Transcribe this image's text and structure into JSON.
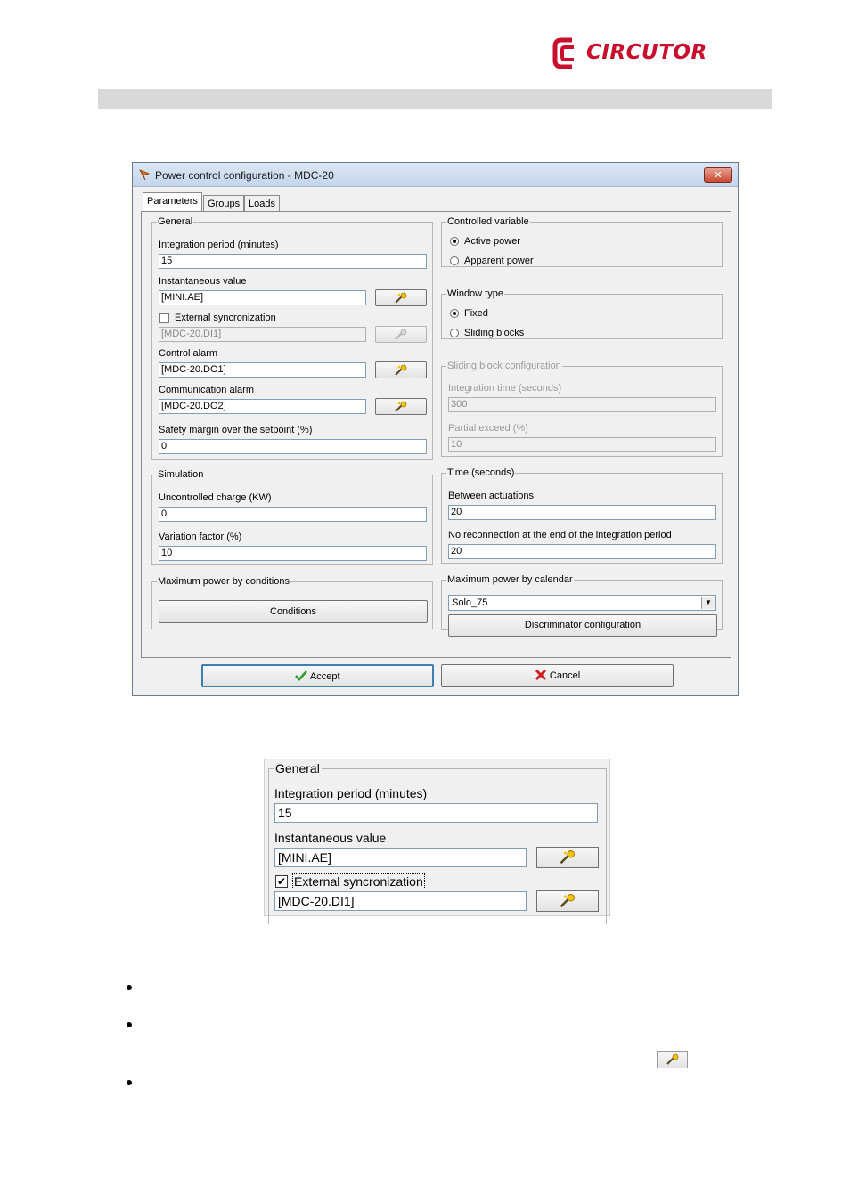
{
  "brand": {
    "logo_text": "CIRCUTOR",
    "color": "#c8102e"
  },
  "window": {
    "title": "Power control configuration - MDC-20",
    "close_glyph": "✕",
    "tabs": [
      "Parameters",
      "Groups",
      "Loads"
    ],
    "active_tab": "Parameters"
  },
  "general": {
    "legend": "General",
    "integration_label": "Integration period (minutes)",
    "integration_value": "15",
    "instantaneous_label": "Instantaneous value",
    "instantaneous_value": "[MINI.AE]",
    "ext_sync_label": "External syncronization",
    "ext_sync_checked": false,
    "ext_sync_value": "[MDC-20.DI1]",
    "control_alarm_label": "Control alarm",
    "control_alarm_value": "[MDC-20.DO1]",
    "comm_alarm_label": "Communication alarm",
    "comm_alarm_value": "[MDC-20.DO2]",
    "safety_label": "Safety margin over the setpoint (%)",
    "safety_value": "0"
  },
  "simulation": {
    "legend": "Simulation",
    "uncontrolled_label": "Uncontrolled charge (KW)",
    "uncontrolled_value": "0",
    "variation_label": "Variation factor (%)",
    "variation_value": "10"
  },
  "max_power_conditions": {
    "legend": "Maximum power by conditions",
    "button": "Conditions"
  },
  "controlled_variable": {
    "legend": "Controlled variable",
    "options": [
      "Active power",
      "Apparent power"
    ],
    "selected": "Active power"
  },
  "window_type": {
    "legend": "Window type",
    "options": [
      "Fixed",
      "Sliding blocks"
    ],
    "selected": "Fixed"
  },
  "sliding_block": {
    "legend": "Sliding block configuration",
    "integration_time_label": "Integration time (seconds)",
    "integration_time_value": "300",
    "partial_exceed_label": "Partial exceed (%)",
    "partial_exceed_value": "10"
  },
  "time": {
    "legend": "Time (seconds)",
    "between_label": "Between actuations",
    "between_value": "20",
    "no_reconnection_label": "No reconnection at the end of the integration period",
    "no_reconnection_value": "20"
  },
  "max_power_calendar": {
    "legend": "Maximum power by calendar",
    "selected": "Solo_75",
    "button": "Discriminator configuration"
  },
  "footer": {
    "accept": "Accept",
    "cancel": "Cancel"
  },
  "zoom": {
    "legend": "General",
    "integration_label": "Integration period (minutes)",
    "integration_value": "15",
    "instantaneous_label": "Instantaneous value",
    "instantaneous_value": "[MINI.AE]",
    "ext_sync_label": "External syncronization",
    "ext_sync_checked": true,
    "check_glyph": "✔",
    "ext_sync_value": "[MDC-20.DI1]"
  },
  "icons": [
    "wand-icon",
    "check-icon",
    "cross-icon",
    "app-icon",
    "dropdown-arrow-icon"
  ],
  "dropdown_glyph": "▼"
}
